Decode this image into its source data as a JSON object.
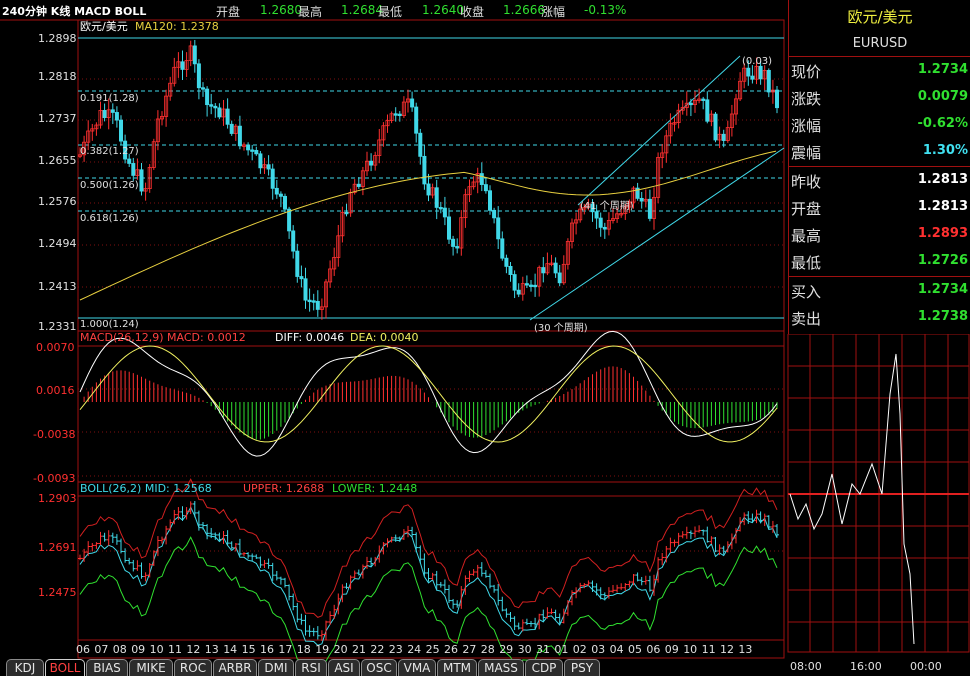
{
  "app_label": "240分钟 K线 MACD BOLL",
  "toolbar": {
    "open_label": "开盘",
    "open_value": "1.2680",
    "high_label": "最高",
    "high_value": "1.2684",
    "low_label": "最低",
    "low_value": "1.2640",
    "close_label": "收盘",
    "close_value": "1.2666",
    "change_label": "涨幅",
    "change_value": "-0.13%"
  },
  "colors": {
    "up": "#ff3030",
    "down": "#40e0f0",
    "ma": "#e8d040",
    "axis": "#c01818",
    "green": "#30e030",
    "white": "#e0e0e0"
  },
  "main_chart": {
    "legend_name": "欧元/美元",
    "legend_ma": "MA120: 1.2378",
    "y_ticks": [
      "1.2898",
      "1.2818",
      "1.2737",
      "1.2655",
      "1.2576",
      "1.2494",
      "1.2413",
      "1.2331"
    ],
    "fib_labels": [
      "0.191(1.28)",
      "0.382(1.27)",
      "0.500(1.26)",
      "0.618(1.26)",
      "1.000(1.24)"
    ],
    "channel_labels": [
      "(0.03)",
      "(41 个周期)",
      "(30 个周期)"
    ]
  },
  "macd_chart": {
    "legend": "MACD(26,12,9) MACD: 0.0012",
    "diff": "DIFF: 0.0046",
    "dea": "DEA: 0.0040",
    "y_ticks": [
      "0.0070",
      "0.0016",
      "-0.0038",
      "-0.0093"
    ]
  },
  "boll_chart": {
    "legend": "BOLL(26,2) MID: 1.2568",
    "upper": "UPPER: 1.2688",
    "lower": "LOWER: 1.2448",
    "y_ticks": [
      "1.2903",
      "1.2691",
      "1.2475"
    ]
  },
  "x_labels": [
    "06",
    "07",
    "08",
    "09",
    "10",
    "11",
    "12",
    "13",
    "14",
    "15",
    "16",
    "17",
    "18",
    "19",
    "20",
    "21",
    "22",
    "23",
    "24",
    "25",
    "26",
    "27",
    "28",
    "29",
    "30",
    "31",
    "01",
    "02",
    "03",
    "04",
    "05",
    "06",
    "09",
    "10",
    "11",
    "12",
    "13"
  ],
  "tabs": [
    "KDJ",
    "BOLL",
    "BIAS",
    "MIKE",
    "ROC",
    "ARBR",
    "DMI",
    "RSI",
    "ASI",
    "OSC",
    "VMA",
    "MTM",
    "MASS",
    "CDP",
    "PSY"
  ],
  "active_tab": "BOLL",
  "quote_panel": {
    "name": "欧元/美元",
    "symbol": "EURUSD",
    "rows": [
      {
        "label": "现价",
        "value": "1.2734",
        "color": "#30e030"
      },
      {
        "label": "涨跌",
        "value": "0.0079",
        "color": "#30e030"
      },
      {
        "label": "涨幅",
        "value": "-0.62%",
        "color": "#30e030"
      },
      {
        "label": "震幅",
        "value": "1.30%",
        "color": "#40e0f0"
      },
      {
        "label": "昨收",
        "value": "1.2813",
        "color": "#ffffff"
      },
      {
        "label": "开盘",
        "value": "1.2813",
        "color": "#ffffff"
      },
      {
        "label": "最高",
        "value": "1.2893",
        "color": "#ff3030"
      },
      {
        "label": "最低",
        "value": "1.2726",
        "color": "#30e030"
      },
      {
        "label": "买入",
        "value": "1.2734",
        "color": "#30e030"
      },
      {
        "label": "卖出",
        "value": "1.2738",
        "color": "#30e030"
      }
    ]
  },
  "intraday": {
    "time_labels": [
      "08:00",
      "16:00",
      "00:00"
    ]
  }
}
